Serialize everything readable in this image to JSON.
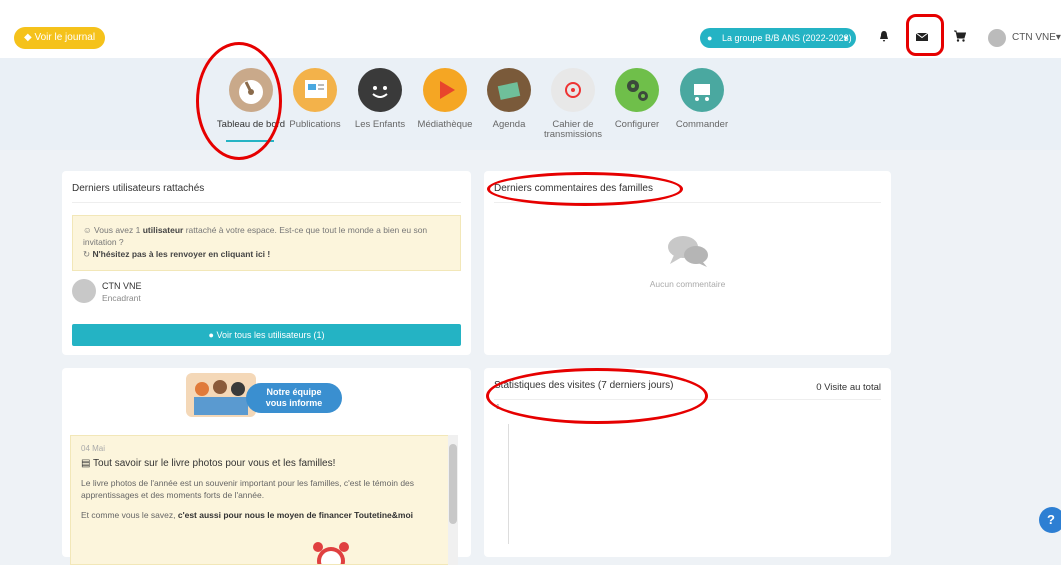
{
  "topbar": {
    "journal_button": "Voir le journal",
    "group_select": "La groupe B/B ANS (2022-2023)",
    "account_name": "CTN VNE"
  },
  "nav": {
    "items": [
      {
        "label": "Tableau de bord",
        "icon": "dashboard-gauge-icon",
        "color": "#c9a98a",
        "active": true
      },
      {
        "label": "Publications",
        "icon": "publications-icon",
        "color": "#f3b24a"
      },
      {
        "label": "Les Enfants",
        "icon": "children-icon",
        "color": "#3a3a3a"
      },
      {
        "label": "Médiathèque",
        "icon": "media-icon",
        "color": "#f5a623"
      },
      {
        "label": "Agenda",
        "icon": "agenda-icon",
        "color": "#7a5a3a"
      },
      {
        "label": "Cahier de transmissions",
        "icon": "notebook-icon",
        "color": "#e8e8e8"
      },
      {
        "label": "Configurer",
        "icon": "gears-icon",
        "color": "#6fbf4a"
      },
      {
        "label": "Commander",
        "icon": "cart-icon",
        "color": "#4aa8a0"
      }
    ]
  },
  "users_card": {
    "title": "Derniers utilisateurs rattachés",
    "notice_line1_pre": "Vous avez 1 ",
    "notice_line1_bold": "utilisateur",
    "notice_line1_post": " rattaché à votre espace. Est-ce que tout le monde a bien eu son invitation ?",
    "notice_line2": "N'hésitez pas à les renvoyer en cliquant ici !",
    "user_name": "CTN VNE",
    "user_role": "Encadrant",
    "button": "Voir tous les utilisateurs (1)"
  },
  "comments_card": {
    "title": "Derniers commentaires des familles",
    "empty": "Aucun commentaire"
  },
  "team_card": {
    "banner_line1": "Notre équipe",
    "banner_line2": "vous informe",
    "news_date": "04 Mai",
    "news_title": "Tout savoir sur le livre photos pour vous et les familles!",
    "news_p1": "Le livre photos de l'année est un souvenir important pour les familles, c'est le témoin des apprentissages et des moments forts de l'année.",
    "news_p2_pre": "Et comme vous le savez, ",
    "news_p2_bold": "c'est aussi pour nous le moyen de financer Toutetine&moi"
  },
  "stats_card": {
    "title": "Statistiques des visites (7 derniers jours)",
    "total": "0 Visite au total",
    "tick": "1"
  },
  "help": "?"
}
